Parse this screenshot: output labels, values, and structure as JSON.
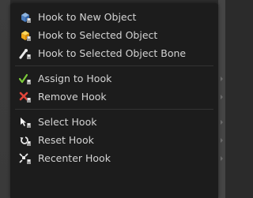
{
  "menu": {
    "groups": [
      {
        "items": [
          {
            "label": "Hook to New Object",
            "icon": "hook-new-object-icon"
          },
          {
            "label": "Hook to Selected Object",
            "icon": "hook-selected-object-icon"
          },
          {
            "label": "Hook to Selected Object Bone",
            "icon": "hook-selected-bone-icon"
          }
        ]
      },
      {
        "items": [
          {
            "label": "Assign to Hook",
            "icon": "assign-hook-icon"
          },
          {
            "label": "Remove Hook",
            "icon": "remove-hook-icon"
          }
        ]
      },
      {
        "items": [
          {
            "label": "Select Hook",
            "icon": "select-hook-icon"
          },
          {
            "label": "Reset Hook",
            "icon": "reset-hook-icon"
          },
          {
            "label": "Recenter Hook",
            "icon": "recenter-hook-icon"
          }
        ]
      }
    ]
  }
}
